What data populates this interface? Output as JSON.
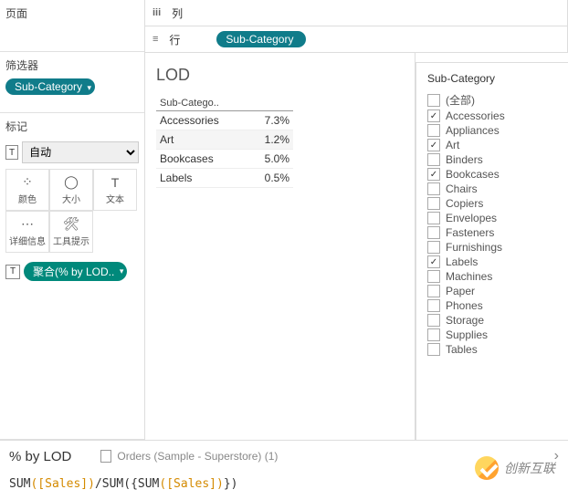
{
  "panels": {
    "pages_title": "页面",
    "filters_title": "筛选器",
    "marks_title": "标记"
  },
  "filter_pill": "Sub-Category",
  "marks_type": "自动",
  "mark_cells": [
    {
      "icon": "⁘",
      "label": "颜色"
    },
    {
      "icon": "◯",
      "label": "大小"
    },
    {
      "icon": "T",
      "label": "文本"
    },
    {
      "icon": "⋯",
      "label": "详细信息"
    },
    {
      "icon": "🛠",
      "label": "工具提示"
    }
  ],
  "agg_pill": "聚合(% by LOD..",
  "columns_label": "列",
  "rows_label": "行",
  "rows_pill": "Sub-Category",
  "viz_title": "LOD",
  "viz_header": "Sub-Catego..",
  "viz_rows": [
    {
      "name": "Accessories",
      "val": "7.3%"
    },
    {
      "name": "Art",
      "val": "1.2%",
      "sel": true
    },
    {
      "name": "Bookcases",
      "val": "5.0%"
    },
    {
      "name": "Labels",
      "val": "0.5%"
    }
  ],
  "side_filter_title": "Sub-Category",
  "side_filter_items": [
    {
      "label": "(全部)",
      "checked": false
    },
    {
      "label": "Accessories",
      "checked": true
    },
    {
      "label": "Appliances",
      "checked": false
    },
    {
      "label": "Art",
      "checked": true
    },
    {
      "label": "Binders",
      "checked": false
    },
    {
      "label": "Bookcases",
      "checked": true
    },
    {
      "label": "Chairs",
      "checked": false
    },
    {
      "label": "Copiers",
      "checked": false
    },
    {
      "label": "Envelopes",
      "checked": false
    },
    {
      "label": "Fasteners",
      "checked": false
    },
    {
      "label": "Furnishings",
      "checked": false
    },
    {
      "label": "Labels",
      "checked": true
    },
    {
      "label": "Machines",
      "checked": false
    },
    {
      "label": "Paper",
      "checked": false
    },
    {
      "label": "Phones",
      "checked": false
    },
    {
      "label": "Storage",
      "checked": false
    },
    {
      "label": "Supplies",
      "checked": false
    },
    {
      "label": "Tables",
      "checked": false
    }
  ],
  "calc_name": "% by LOD",
  "datasource": "Orders (Sample - Superstore) (1)",
  "formula": {
    "raw": "SUM([Sales])/SUM({SUM([Sales])})",
    "p1": "SUM",
    "f1": "([Sales])",
    "div": "/",
    "p2": "SUM",
    "lb": "({",
    "p3": "SUM",
    "f2": "([Sales])",
    "rb": "})"
  },
  "watermark": "创新互联"
}
